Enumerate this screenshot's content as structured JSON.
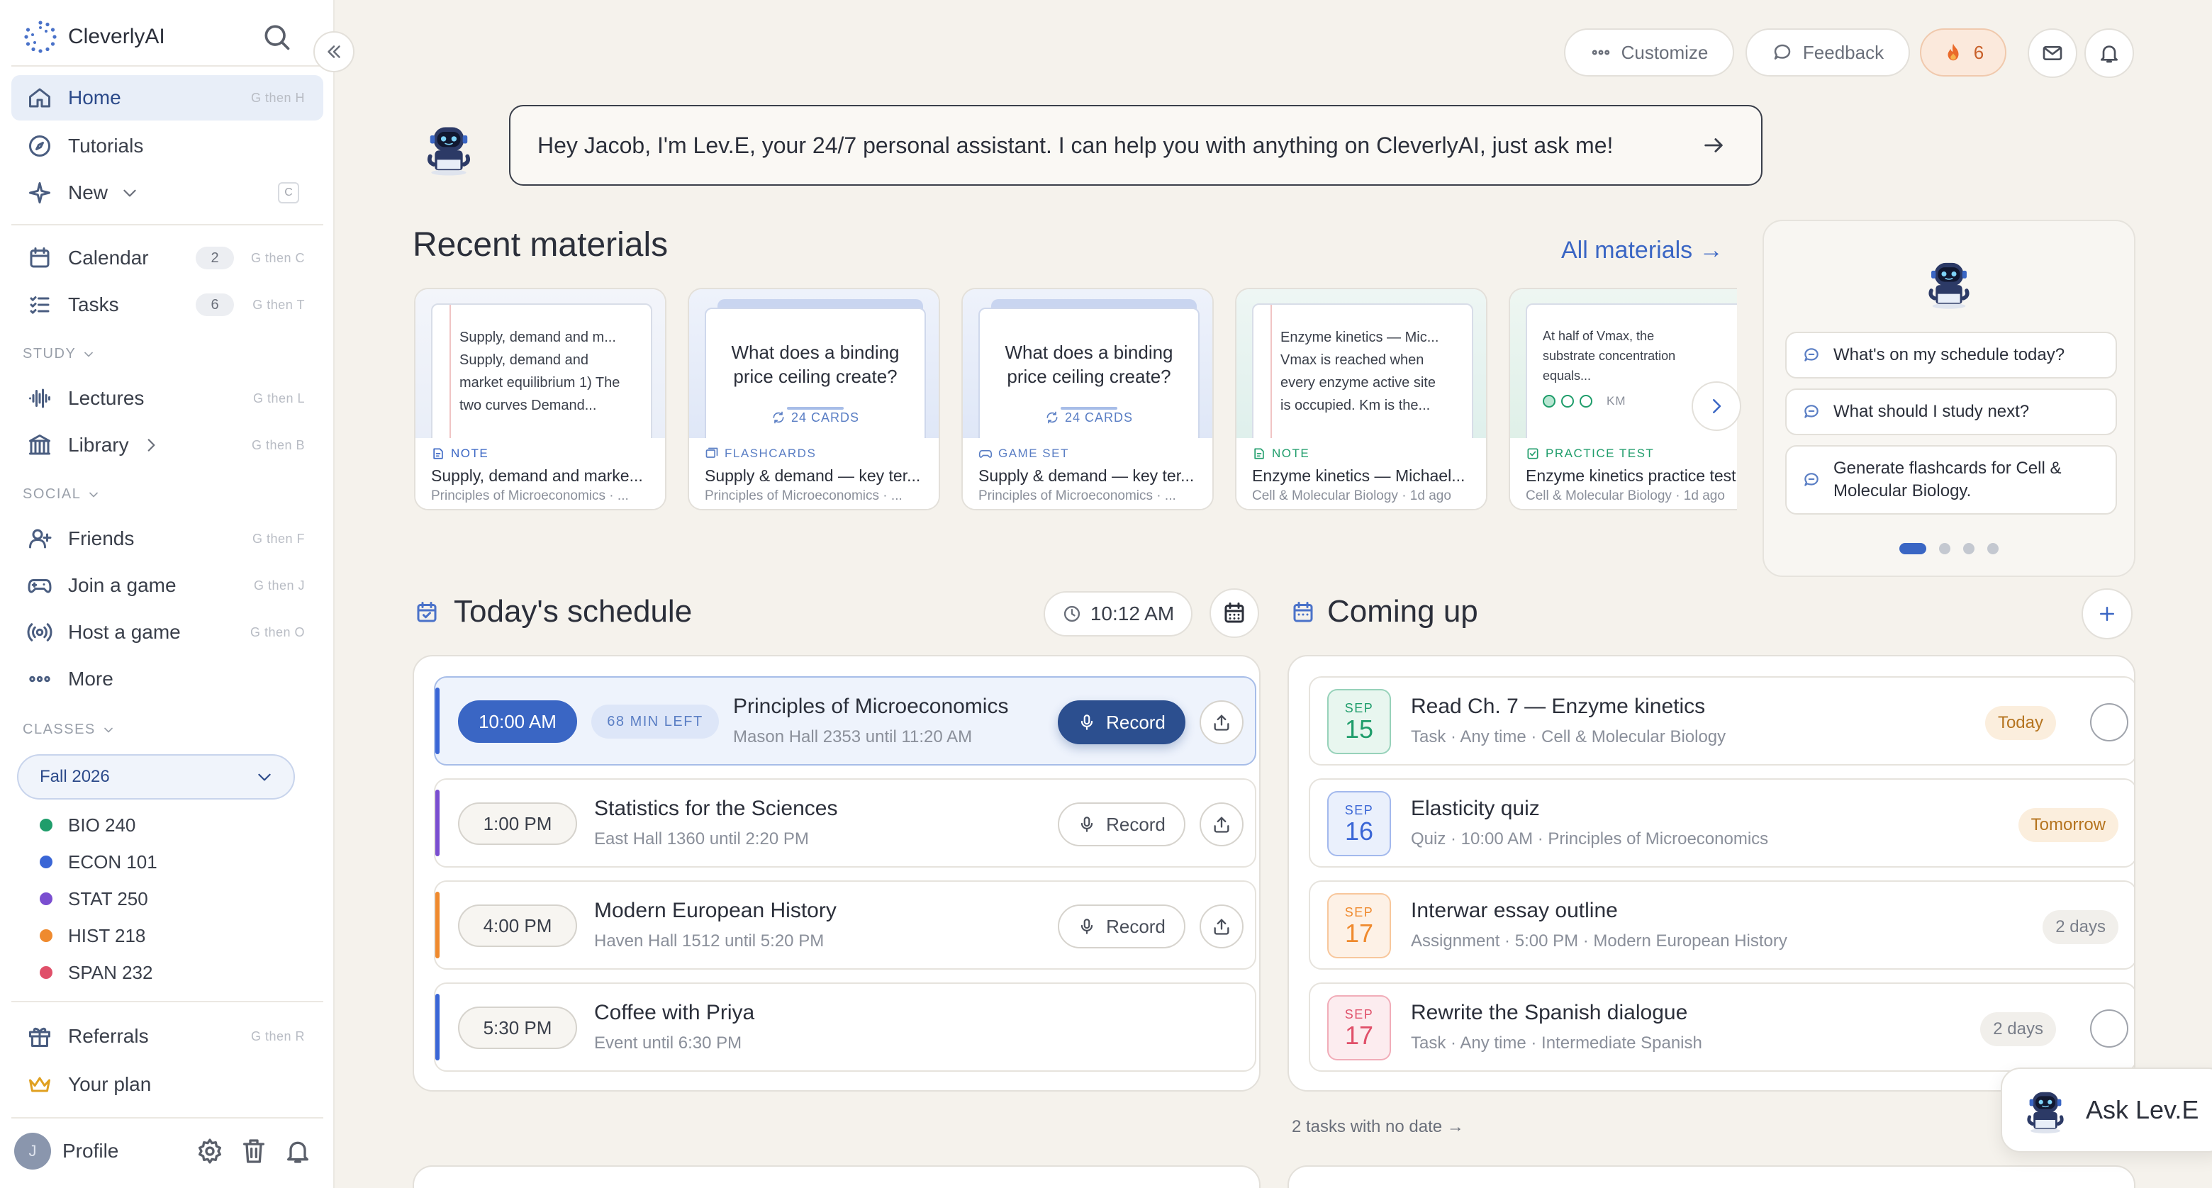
{
  "app": {
    "name": "CleverlyAI"
  },
  "sidebar": {
    "nav": [
      {
        "label": "Home",
        "shortcut": "G then H"
      },
      {
        "label": "Tutorials",
        "shortcut": ""
      },
      {
        "label": "New",
        "shortcut": "C"
      }
    ],
    "planning": [
      {
        "label": "Calendar",
        "count": "2",
        "shortcut": "G then C"
      },
      {
        "label": "Tasks",
        "count": "6",
        "shortcut": "G then T"
      }
    ],
    "study_label": "STUDY",
    "study": [
      {
        "label": "Lectures",
        "shortcut": "G then L"
      },
      {
        "label": "Library",
        "shortcut": "G then B"
      }
    ],
    "social_label": "SOCIAL",
    "social": [
      {
        "label": "Friends",
        "shortcut": "G then F"
      },
      {
        "label": "Join a game",
        "shortcut": "G then J"
      },
      {
        "label": "Host a game",
        "shortcut": "G then O"
      },
      {
        "label": "More",
        "shortcut": ""
      }
    ],
    "classes_label": "CLASSES",
    "term": "Fall 2026",
    "classes": [
      {
        "label": "BIO 240",
        "color": "#1f9d6b"
      },
      {
        "label": "ECON 101",
        "color": "#3a66d6"
      },
      {
        "label": "STAT 250",
        "color": "#7a4ed0"
      },
      {
        "label": "HIST 218",
        "color": "#ef8a2e"
      },
      {
        "label": "SPAN 232",
        "color": "#e0506a"
      }
    ],
    "footer": [
      {
        "label": "Referrals",
        "shortcut": "G then R"
      },
      {
        "label": "Your plan",
        "shortcut": ""
      }
    ],
    "profile": {
      "initial": "J",
      "label": "Profile"
    }
  },
  "topbar": {
    "customize": "Customize",
    "feedback": "Feedback",
    "streak": "6"
  },
  "assistant": {
    "greeting": "Hey Jacob, I'm Lev.E, your 24/7 personal assistant. I can help you with anything on CleverlyAI, just ask me!"
  },
  "recent": {
    "title": "Recent materials",
    "all_link": "All materials →",
    "cards": [
      {
        "type": "NOTE",
        "preview": [
          "Supply, demand and m...",
          "Supply, demand and",
          "market equilibrium 1) The",
          "two curves Demand..."
        ],
        "title": "Supply, demand and marke...",
        "sub": "Principles of Microeconomics · ...",
        "color": "#3a66c4"
      },
      {
        "type": "FLASHCARDS",
        "preview": [
          "What does a binding",
          "price ceiling create?"
        ],
        "cards": "24 CARDS",
        "title": "Supply & demand — key ter...",
        "sub": "Principles of Microeconomics · ...",
        "color": "#5a7ec4"
      },
      {
        "type": "GAME SET",
        "preview": [
          "What does a binding",
          "price ceiling create?"
        ],
        "cards": "24 CARDS",
        "title": "Supply & demand — key ter...",
        "sub": "Principles of Microeconomics · ...",
        "color": "#5a7ec4"
      },
      {
        "type": "NOTE",
        "preview": [
          "Enzyme kinetics — Mic...",
          "Vmax is reached when",
          "every enzyme active site",
          "is occupied. Km is the..."
        ],
        "title": "Enzyme kinetics — Michael...",
        "sub": "Cell & Molecular Biology · 1d ago",
        "color": "#1f9d6b"
      },
      {
        "type": "PRACTICE TEST",
        "preview": [
          "At half of Vmax, the",
          "substrate concentration",
          "equals..."
        ],
        "option": "KM",
        "title": "Enzyme kinetics practice test",
        "sub": "Cell & Molecular Biology · 1d ago",
        "color": "#1f9d6b"
      }
    ]
  },
  "suggestions": [
    "What's on my schedule today?",
    "What should I study next?",
    "Generate flashcards for Cell & Molecular Biology."
  ],
  "schedule": {
    "title": "Today's schedule",
    "clock": "10:12 AM",
    "items": [
      {
        "time": "10:00 AM",
        "left": "68 MIN LEFT",
        "title": "Principles of Microeconomics",
        "sub": "Mason Hall 2353 until 11:20 AM",
        "record": "Record",
        "color": "#3a66d6"
      },
      {
        "time": "1:00 PM",
        "title": "Statistics for the Sciences",
        "sub": "East Hall 1360 until 2:20 PM",
        "record": "Record",
        "color": "#7a4ed0"
      },
      {
        "time": "4:00 PM",
        "title": "Modern European History",
        "sub": "Haven Hall 1512 until 5:20 PM",
        "record": "Record",
        "color": "#ef8a2e"
      },
      {
        "time": "5:30 PM",
        "title": "Coffee with Priya",
        "sub": "Event until 6:30 PM",
        "color": "#3a66d6"
      }
    ]
  },
  "coming_up": {
    "title": "Coming up",
    "items": [
      {
        "month": "SEP",
        "day": "15",
        "title": "Read Ch. 7 — Enzyme kinetics",
        "sub": "Task · Any time · Cell & Molecular Biology",
        "badge": "Today",
        "accent": "#1f9d6b"
      },
      {
        "month": "SEP",
        "day": "16",
        "title": "Elasticity quiz",
        "sub": "Quiz · 10:00 AM · Principles of Microeconomics",
        "badge": "Tomorrow",
        "accent": "#3a66d6"
      },
      {
        "month": "SEP",
        "day": "17",
        "title": "Interwar essay outline",
        "sub": "Assignment · 5:00 PM · Modern European History",
        "badge": "2 days",
        "accent": "#ef8a2e"
      },
      {
        "month": "SEP",
        "day": "17",
        "title": "Rewrite the Spanish dialogue",
        "sub": "Task · Any time · Intermediate Spanish",
        "badge": "2 days",
        "accent": "#e0506a"
      }
    ],
    "no_date_link": "2 tasks with no date →"
  },
  "ask": {
    "label": "Ask Lev.E"
  }
}
